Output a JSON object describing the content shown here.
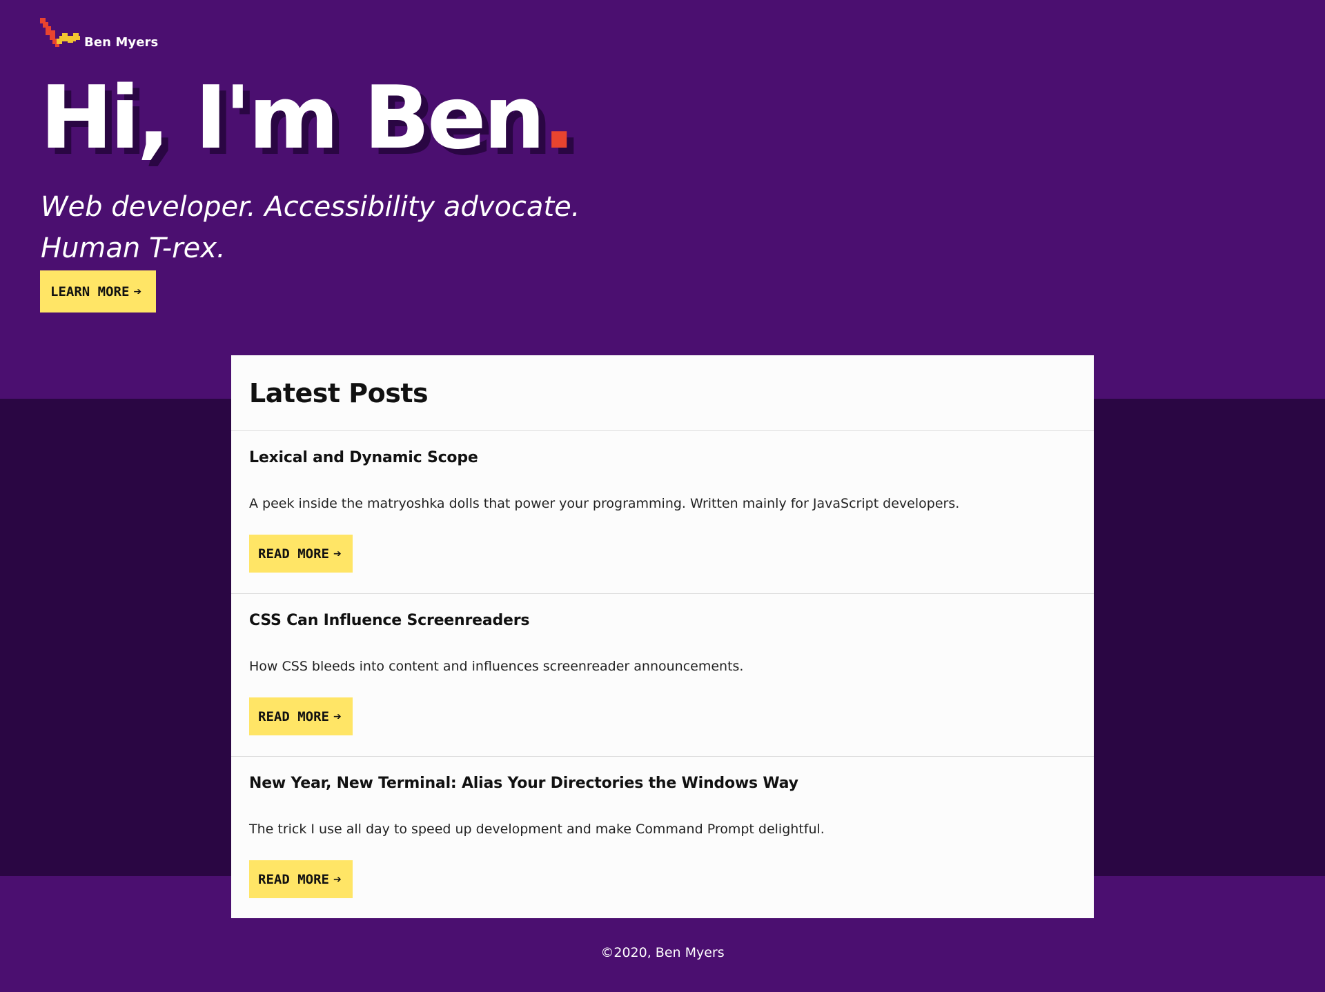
{
  "site": {
    "brand_name": "Ben Myers",
    "logo_icon": "lightning-bolt-icon",
    "colors": {
      "hero_bg": "#4b0f70",
      "band_bg": "#2a0643",
      "accent_red": "#e8442f",
      "button_yellow": "#ffe566",
      "logo_yellow": "#f2c531"
    }
  },
  "hero": {
    "title_text": "Hi, I'm Ben",
    "title_dot": ".",
    "tagline": "Web developer. Accessibility advocate. Human T-rex.",
    "cta_label": "LEARN MORE",
    "cta_arrow": "➔"
  },
  "posts": {
    "heading": "Latest Posts",
    "items": [
      {
        "title": "Lexical and Dynamic Scope",
        "description": "A peek inside the matryoshka dolls that power your programming. Written mainly for JavaScript developers.",
        "button_label": "READ MORE"
      },
      {
        "title": "CSS Can Influence Screenreaders",
        "description": "How CSS bleeds into content and influences screenreader announcements.",
        "button_label": "READ MORE"
      },
      {
        "title": "New Year, New Terminal: Alias Your Directories the Windows Way",
        "description": "The trick I use all day to speed up development and make Command Prompt delightful.",
        "button_label": "READ MORE"
      }
    ],
    "button_arrow": "➔"
  },
  "footer": {
    "copyright": "©2020, Ben Myers"
  }
}
